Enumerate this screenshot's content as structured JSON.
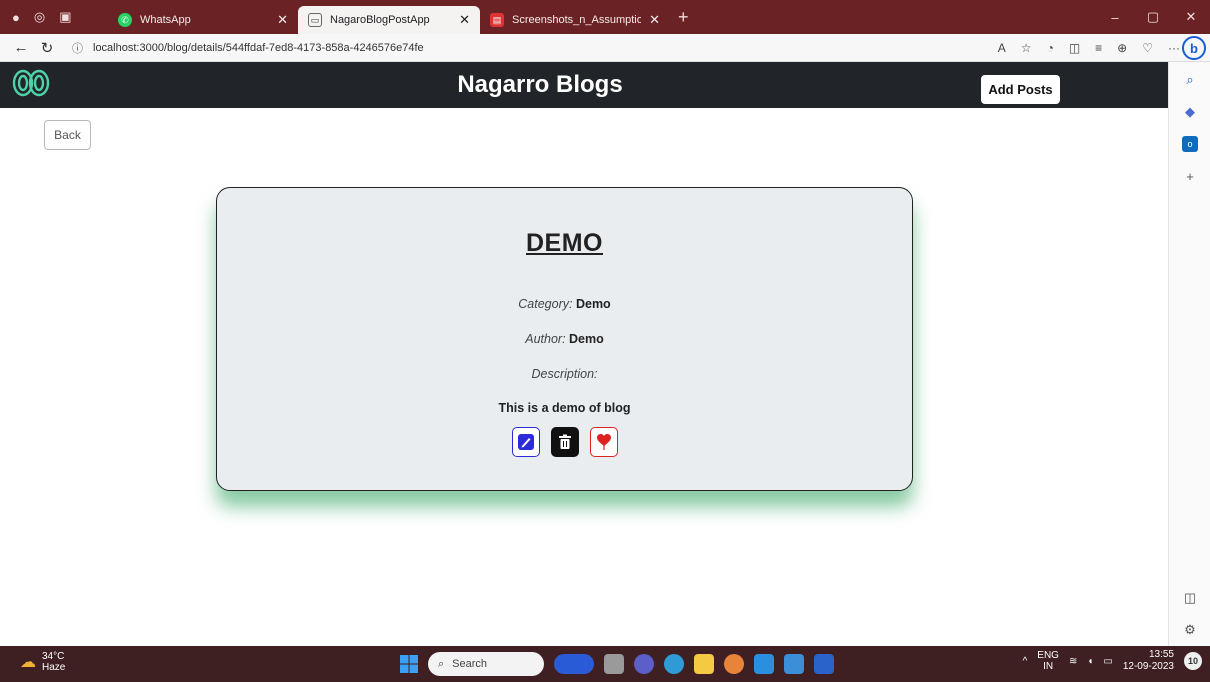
{
  "browser": {
    "tabs": [
      {
        "label": "WhatsApp",
        "icon": "whatsapp-icon",
        "active": false
      },
      {
        "label": "NagaroBlogPostApp",
        "icon": "page-icon",
        "active": true
      },
      {
        "label": "Screenshots_n_Assumptions.pdf",
        "icon": "pdf-icon",
        "active": false
      }
    ],
    "url": "localhost:3000/blog/details/544ffdaf-7ed8-4173-858a-4246576e74fe"
  },
  "navbar": {
    "title": "Nagarro Blogs",
    "add_posts_label": "Add Posts"
  },
  "page": {
    "back_label": "Back"
  },
  "post": {
    "title": "DEMO",
    "category_label": "Category:",
    "category": "Demo",
    "author_label": "Author:",
    "author": "Demo",
    "description_label": "Description:",
    "description": "This is a demo of blog",
    "actions": [
      "edit-icon",
      "delete-icon",
      "like-icon"
    ]
  },
  "taskbar": {
    "temperature": "34°C",
    "weather": "Haze",
    "search_placeholder": "Search",
    "lang_top": "ENG",
    "lang_bottom": "IN",
    "time": "13:55",
    "date": "12-09-2023",
    "notification_count": "10"
  },
  "colors": {
    "tabbar": "#6b2224",
    "navbar": "#212529",
    "card_bg": "#e9edf0",
    "card_shadow": "#28a05a",
    "edit_blue": "#2b2bd9",
    "like_red": "#dd2222"
  }
}
